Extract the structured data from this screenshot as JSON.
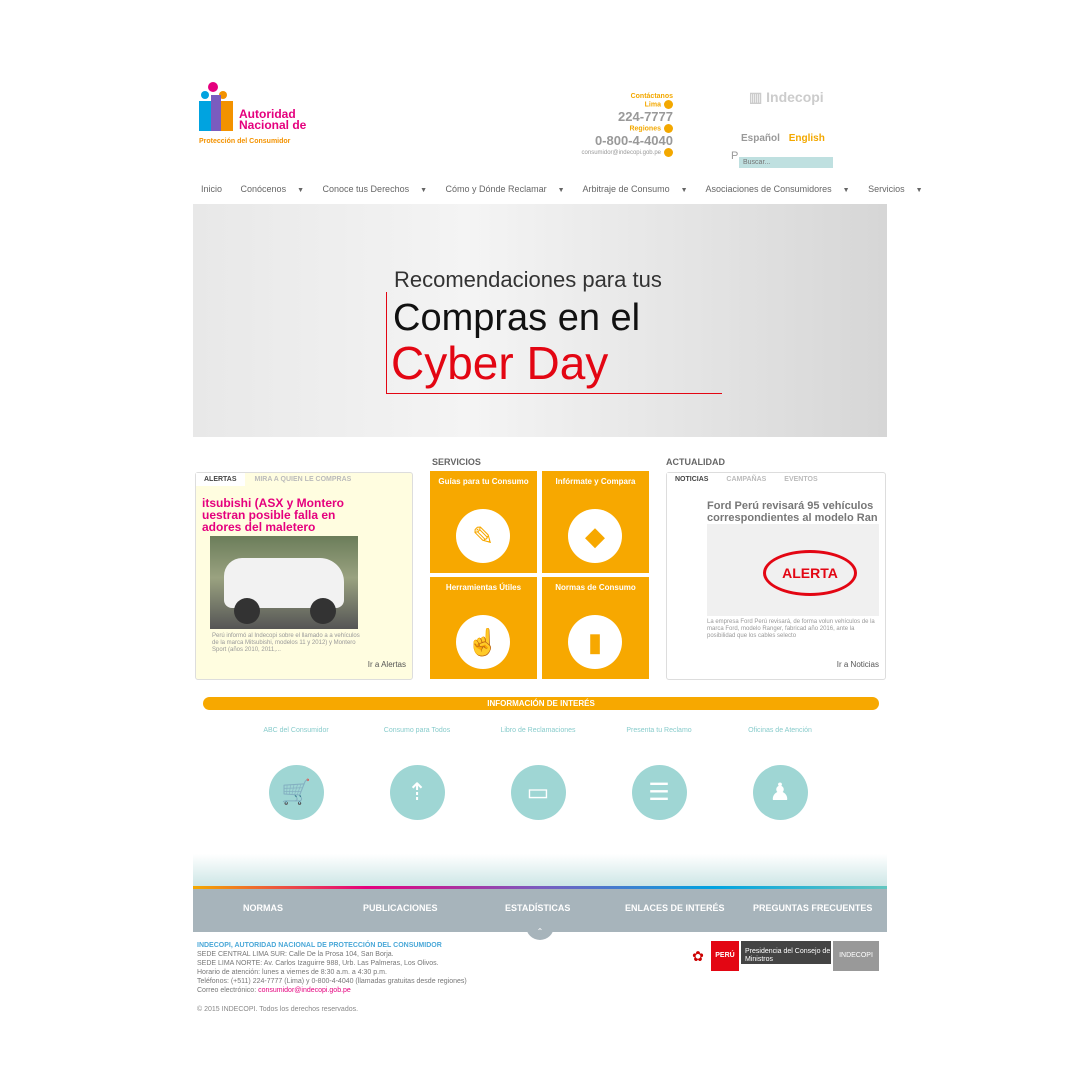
{
  "header": {
    "logo_line1": "Autoridad",
    "logo_line2": "Nacional de",
    "logo_sub": "Protección del Consumidor",
    "contact_label": "Contáctanos",
    "lima_label": "Lima",
    "lima_phone": "224-7777",
    "regions_label": "Regiones",
    "regions_phone": "0-800-4-4040",
    "email": "consumidor@indecopi.gob.pe",
    "indecopi": "Indecopi",
    "lang_es": "Español",
    "lang_en": "English",
    "search_placeholder": "Buscar..."
  },
  "nav": {
    "items": [
      {
        "label": "Inicio"
      },
      {
        "label": "Conócenos"
      },
      {
        "label": "Conoce tus Derechos"
      },
      {
        "label": "Cómo y Dónde Reclamar"
      },
      {
        "label": "Arbitraje de Consumo"
      },
      {
        "label": "Asociaciones de Consumidores"
      },
      {
        "label": "Servicios"
      }
    ]
  },
  "banner": {
    "small": "Recomendaciones para tus",
    "line1": "Compras en el",
    "line2": "Cyber Day"
  },
  "alerts": {
    "tab_active": "ALERTAS",
    "tab_inactive": "MIRA A QUIEN LE COMPRAS",
    "title": "itsubishi (ASX y Montero uestran posible falla en adores del maletero",
    "desc": "Perú informó al Indecopi sobre el llamado a a vehículos de la marca Mitsubishi, modelos 11 y 2012) y Montero Sport (años 2010, 2011,...",
    "more": "Ir a Alertas"
  },
  "services": {
    "heading": "SERVICIOS",
    "tiles": [
      {
        "label": "Guías para tu Consumo",
        "icon": "guide-icon"
      },
      {
        "label": "Infórmate y Compara",
        "icon": "tag-icon"
      },
      {
        "label": "Herramientas Útiles",
        "icon": "tools-icon"
      },
      {
        "label": "Normas de Consumo",
        "icon": "book-icon"
      }
    ]
  },
  "news": {
    "heading": "ACTUALIDAD",
    "tab_active": "NOTICIAS",
    "tab2": "CAMPAÑAS",
    "tab3": "EVENTOS",
    "title": "Ford Perú revisará 95 vehículos correspondientes al modelo Ran",
    "alert_word": "ALERTA",
    "desc": "La empresa Ford Perú revisará, de forma volun vehículos de la marca Ford, modelo Ranger, fabricad año 2016, ante la posibilidad que los cables selecto",
    "more": "Ir a Noticias"
  },
  "info": {
    "heading": "INFORMACIÓN DE INTERÉS",
    "items": [
      {
        "label": "ABC del Consumidor",
        "icon": "cart-icon"
      },
      {
        "label": "Consumo para Todos",
        "icon": "people-icon"
      },
      {
        "label": "Libro de Reclamaciones",
        "icon": "open-book-icon"
      },
      {
        "label": "Presenta tu Reclamo",
        "icon": "document-icon"
      },
      {
        "label": "Oficinas de Atención",
        "icon": "office-icon"
      }
    ]
  },
  "footer": {
    "nav": [
      "NORMAS",
      "PUBLICACIONES",
      "ESTADÍSTICAS",
      "ENLACES DE INTERÉS",
      "PREGUNTAS FRECUENTES"
    ],
    "org": "INDECOPI, AUTORIDAD NACIONAL DE PROTECCIÓN DEL CONSUMIDOR",
    "sede1": "SEDE CENTRAL LIMA SUR: Calle De la Prosa 104, San Borja.",
    "sede2": "SEDE LIMA NORTE: Av. Carlos Izaguirre 988, Urb. Las Palmeras, Los Olivos.",
    "hours": "Horario de atención: lunes a viernes de 8:30 a.m. a 4:30 p.m.",
    "phones": "Teléfonos: (+511) 224-7777 (Lima) y 0-800-4-4040 (llamadas gratuitas desde regiones)",
    "email_label": "Correo electrónico:",
    "email": "consumidor@indecopi.gob.pe",
    "copyright": "© 2015 INDECOPI. Todos los derechos reservados.",
    "gov_peru": "PERÚ",
    "gov_pcm": "Presidencia del Consejo de Ministros",
    "gov_indecopi": "INDECOPI"
  }
}
